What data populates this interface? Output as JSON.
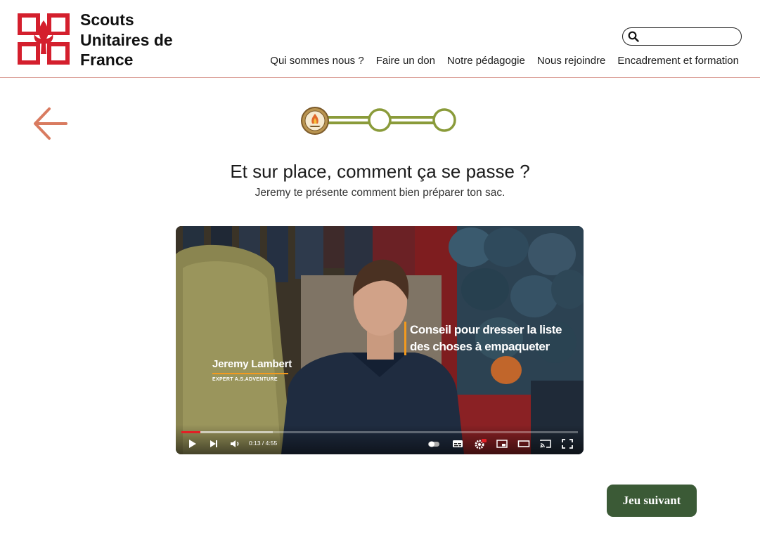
{
  "brand": {
    "line1": "Scouts",
    "line2": "Unitaires de",
    "line3": "France"
  },
  "search": {
    "placeholder": "",
    "value": "",
    "icon": "search-icon"
  },
  "nav": [
    {
      "label": "Qui sommes nous ?"
    },
    {
      "label": "Faire un don"
    },
    {
      "label": "Notre pédagogie"
    },
    {
      "label": "Nous rejoindre"
    },
    {
      "label": "Encadrement et formation"
    }
  ],
  "back": {
    "icon": "arrow-left-icon",
    "color": "#d97b60"
  },
  "progress": {
    "current_step": 1,
    "total_steps": 3,
    "color": "#8a9b3a"
  },
  "heading": {
    "title": "Et sur place, comment ça se passe ?",
    "subtitle": "Jeremy te présente comment bien préparer ton sac."
  },
  "video": {
    "lower_third_name": "Jeremy Lambert",
    "lower_third_role": "EXPERT A.S.ADVENTURE",
    "caption_line1": "Conseil pour dresser la liste",
    "caption_line2": "des choses à empaqueter",
    "time": "0:13 / 4:55",
    "played_fraction": 0.047,
    "accent": "#f39a1e"
  },
  "next_button": {
    "label": "Jeu suivant",
    "color": "#3b5a36"
  },
  "colors": {
    "logo_red": "#d41f2d",
    "divider": "#d99a93"
  }
}
